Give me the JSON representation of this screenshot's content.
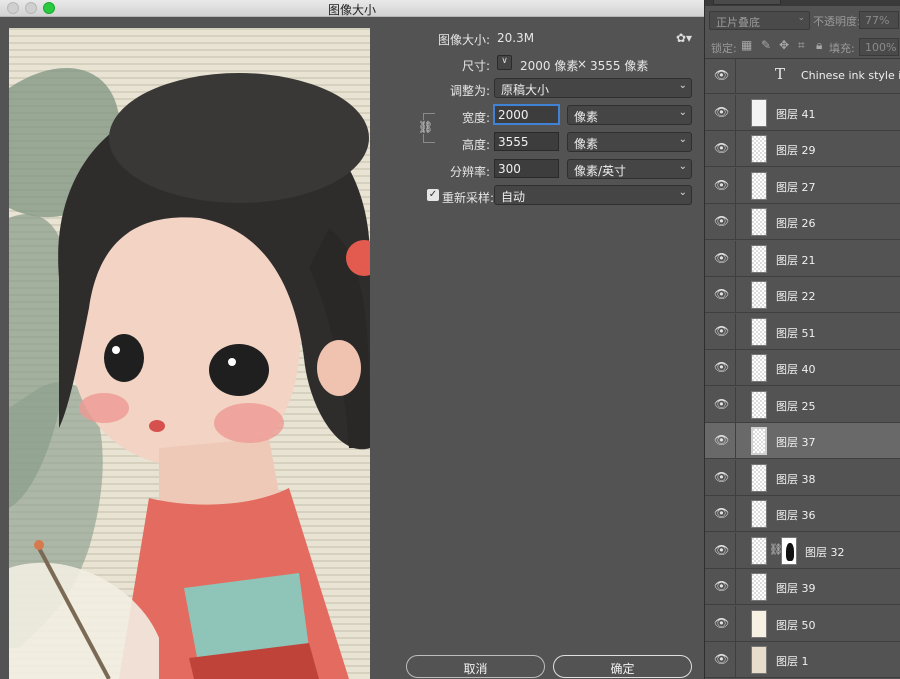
{
  "dialog": {
    "title": "图像大小",
    "image_size_label": "图像大小:",
    "image_size_value": "20.3M",
    "dimensions_label": "尺寸:",
    "dimensions_width": "2000 像素",
    "dimensions_times": "×",
    "dimensions_height": "3555 像素",
    "fit_to_label": "调整为:",
    "fit_to_value": "原稿大小",
    "width_label": "宽度:",
    "width_value": "2000",
    "width_unit": "像素",
    "height_label": "高度:",
    "height_value": "3555",
    "height_unit": "像素",
    "resolution_label": "分辨率:",
    "resolution_value": "300",
    "resolution_unit": "像素/英寸",
    "resample_label": "重新采样:",
    "resample_value": "自动",
    "resample_checked": true,
    "cancel_label": "取消",
    "ok_label": "确定"
  },
  "layers_panel": {
    "blend_mode": "正片叠底",
    "opacity_label": "不透明度:",
    "opacity_value": "77%",
    "lock_label": "锁定:",
    "fill_label": "填充:",
    "fill_value": "100%",
    "layers": [
      {
        "name": "Chinese ink style illus",
        "kind": "text"
      },
      {
        "name": "图层 41",
        "kind": "white"
      },
      {
        "name": "图层 29",
        "kind": "transparent"
      },
      {
        "name": "图层 27",
        "kind": "transparent"
      },
      {
        "name": "图层 26",
        "kind": "transparent"
      },
      {
        "name": "图层 21",
        "kind": "transparent"
      },
      {
        "name": "图层 22",
        "kind": "transparent"
      },
      {
        "name": "图层 51",
        "kind": "transparent"
      },
      {
        "name": "图层 40",
        "kind": "transparent"
      },
      {
        "name": "图层 25",
        "kind": "transparent"
      },
      {
        "name": "图层 37",
        "kind": "selected"
      },
      {
        "name": "图层 38",
        "kind": "transparent"
      },
      {
        "name": "图层 36",
        "kind": "transparent"
      },
      {
        "name": "图层 32",
        "kind": "masked"
      },
      {
        "name": "图层 39",
        "kind": "transparent"
      },
      {
        "name": "图层 50",
        "kind": "cream"
      },
      {
        "name": "图层 1",
        "kind": "beige"
      }
    ]
  }
}
